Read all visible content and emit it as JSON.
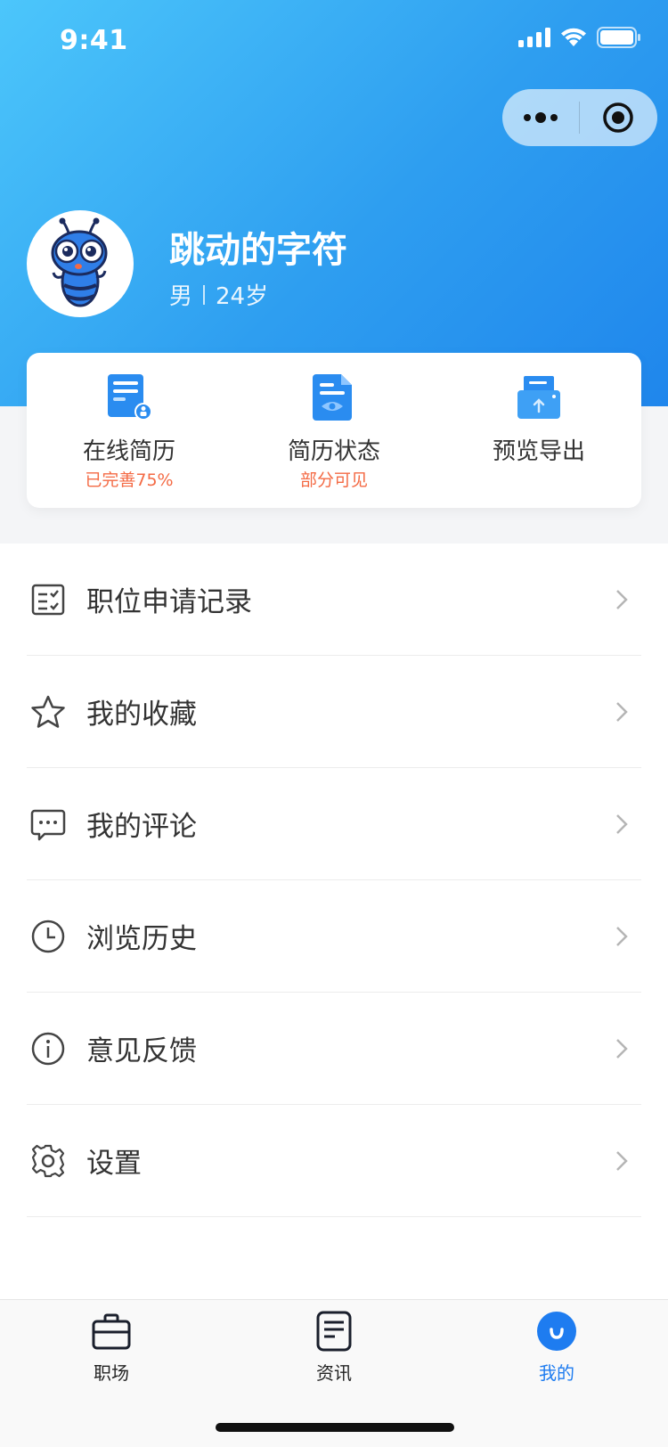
{
  "status_bar": {
    "time": "9:41"
  },
  "profile": {
    "name": "跳动的字符",
    "gender": "男",
    "age": "24岁"
  },
  "resume_card": [
    {
      "title": "在线简历",
      "subtitle": "已完善75%",
      "icon": "resume-icon"
    },
    {
      "title": "简历状态",
      "subtitle": "部分可见",
      "icon": "visibility-doc-icon"
    },
    {
      "title": "预览导出",
      "subtitle": "",
      "icon": "export-icon"
    }
  ],
  "menu": [
    {
      "label": "职位申请记录",
      "icon": "checklist-icon"
    },
    {
      "label": "我的收藏",
      "icon": "star-icon"
    },
    {
      "label": "我的评论",
      "icon": "comment-icon"
    },
    {
      "label": "浏览历史",
      "icon": "clock-icon"
    },
    {
      "label": "意见反馈",
      "icon": "info-icon"
    },
    {
      "label": "设置",
      "icon": "gear-icon"
    }
  ],
  "tabbar": [
    {
      "label": "职场",
      "icon": "briefcase-icon",
      "active": false
    },
    {
      "label": "资讯",
      "icon": "news-icon",
      "active": false
    },
    {
      "label": "我的",
      "icon": "profile-icon",
      "active": true
    }
  ],
  "colors": {
    "accent": "#1e7cf0",
    "header_gradient_start": "#4cc6fb",
    "header_gradient_end": "#1f86ec",
    "highlight_text": "#f46a44"
  }
}
